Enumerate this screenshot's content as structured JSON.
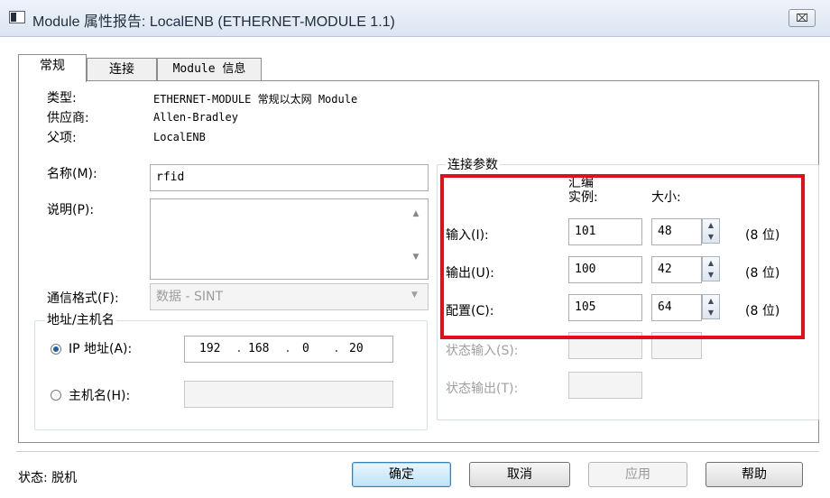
{
  "window": {
    "title": "Module 属性报告: LocalENB (ETHERNET-MODULE 1.1)",
    "close_label": "⌧"
  },
  "tabs": [
    {
      "label": "常规",
      "active": true
    },
    {
      "label": "连接",
      "active": false
    },
    {
      "label": "Module 信息",
      "active": false
    }
  ],
  "general": {
    "type_label": "类型:",
    "type_value": "ETHERNET-MODULE 常规以太网 Module",
    "vendor_label": "供应商:",
    "vendor_value": "Allen-Bradley",
    "parent_label": "父项:",
    "parent_value": "LocalENB",
    "name_label": "名称(M):",
    "name_value": "rfid",
    "desc_label": "说明(P):",
    "desc_value": "",
    "comm_format_label": "通信格式(F):",
    "comm_format_value": "数据 - SINT"
  },
  "address": {
    "group_title": "地址/主机名",
    "ip_label": "IP 地址(A):",
    "ip_selected": true,
    "ip_octets": [
      "192",
      "168",
      "0",
      "20"
    ],
    "host_label": "主机名(H):",
    "host_value": ""
  },
  "connection_params": {
    "group_title": "连接参数",
    "header_assembly_1": "汇编",
    "header_assembly_2": "实例:",
    "header_size": "大小:",
    "rows": [
      {
        "label": "输入(I):",
        "instance": "101",
        "size": "48",
        "unit": "(8 位)"
      },
      {
        "label": "输出(U):",
        "instance": "100",
        "size": "42",
        "unit": "(8 位)"
      },
      {
        "label": "配置(C):",
        "instance": "105",
        "size": "64",
        "unit": "(8 位)"
      }
    ],
    "status_input_label": "状态输入(S):",
    "status_output_label": "状态输出(T):"
  },
  "footer": {
    "status_text": "状态: 脱机",
    "ok_label": "确定",
    "cancel_label": "取消",
    "apply_label": "应用",
    "help_label": "帮助"
  },
  "colors": {
    "highlight_box": "#e0101a",
    "titlebar": "#dbe5f1",
    "primary_button": "#bfe3f9"
  }
}
